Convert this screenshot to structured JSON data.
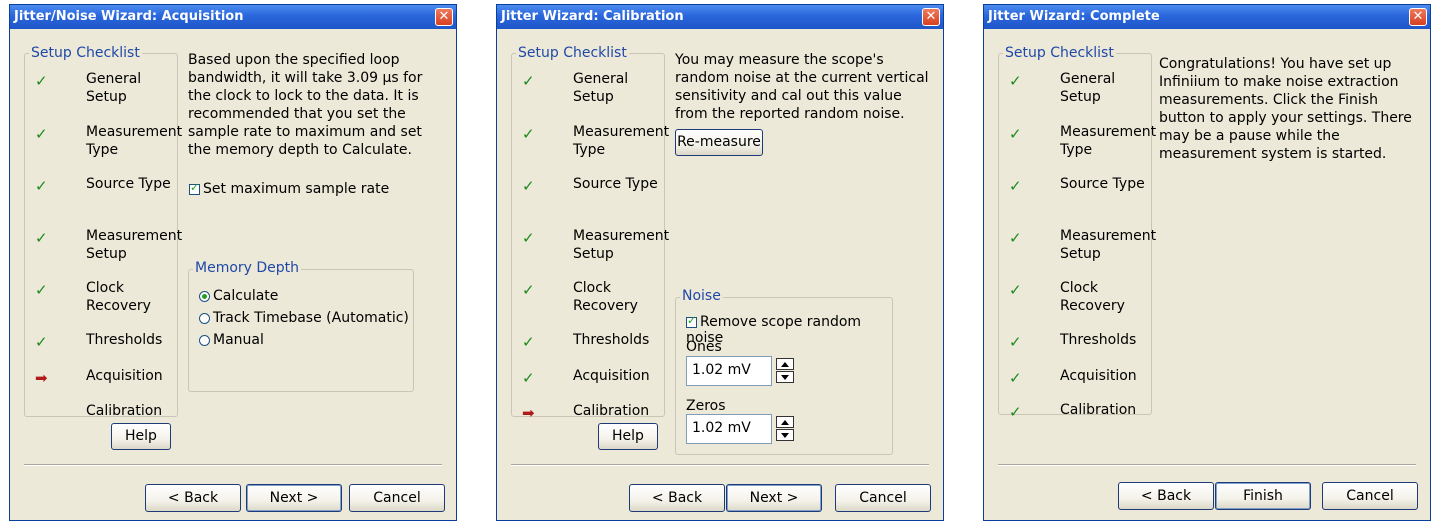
{
  "dialogs": [
    {
      "title": "Jitter/Noise Wizard: Acquisition",
      "checklist_title": "Setup Checklist",
      "items": [
        {
          "label": "General Setup",
          "status": "check"
        },
        {
          "label": "Measurement Type",
          "status": "check"
        },
        {
          "label": "Source Type",
          "status": "check"
        },
        {
          "label": "Measurement Setup",
          "status": "check"
        },
        {
          "label": "Clock Recovery",
          "status": "check"
        },
        {
          "label": "Thresholds",
          "status": "check"
        },
        {
          "label": "Acquisition",
          "status": "current"
        },
        {
          "label": "Calibration",
          "status": "none"
        }
      ],
      "description": "Based upon the specified loop bandwidth, it will take 3.09 µs for the clock to lock to the data. It is recommended that you set the sample rate to maximum and set the memory depth to Calculate.",
      "checkbox_label": "Set maximum sample rate",
      "memory_depth": {
        "title": "Memory Depth",
        "options": [
          "Calculate",
          "Track Timebase (Automatic)",
          "Manual"
        ],
        "selected": "Calculate"
      },
      "help_label": "Help",
      "back_label": "< Back",
      "next_label": "Next >",
      "cancel_label": "Cancel"
    },
    {
      "title": "Jitter Wizard: Calibration",
      "checklist_title": "Setup Checklist",
      "items": [
        {
          "label": "General Setup",
          "status": "check"
        },
        {
          "label": "Measurement Type",
          "status": "check"
        },
        {
          "label": "Source Type",
          "status": "check"
        },
        {
          "label": "Measurement Setup",
          "status": "check"
        },
        {
          "label": "Clock Recovery",
          "status": "check"
        },
        {
          "label": "Thresholds",
          "status": "check"
        },
        {
          "label": "Acquisition",
          "status": "check"
        },
        {
          "label": "Calibration",
          "status": "current"
        }
      ],
      "description": "You may measure the scope's random noise at the current vertical sensitivity and cal out this value from the reported random noise.",
      "remeasure_label": "Re-measure",
      "noise": {
        "title": "Noise",
        "checkbox_label": "Remove scope random noise",
        "ones_label": "Ones",
        "ones_value": "1.02 mV",
        "zeros_label": "Zeros",
        "zeros_value": "1.02 mV"
      },
      "help_label": "Help",
      "back_label": "< Back",
      "next_label": "Next >",
      "cancel_label": "Cancel"
    },
    {
      "title": "Jitter Wizard: Complete",
      "checklist_title": "Setup Checklist",
      "items": [
        {
          "label": "General Setup",
          "status": "check"
        },
        {
          "label": "Measurement Type",
          "status": "check"
        },
        {
          "label": "Source Type",
          "status": "check"
        },
        {
          "label": "Measurement Setup",
          "status": "check"
        },
        {
          "label": "Clock Recovery",
          "status": "check"
        },
        {
          "label": "Thresholds",
          "status": "check"
        },
        {
          "label": "Acquisition",
          "status": "check"
        },
        {
          "label": "Calibration",
          "status": "check"
        }
      ],
      "description": "Congratulations! You have set up Infiniium to make noise extraction measurements. Click the Finish button to apply your settings. There may be a pause while the measurement system is started.",
      "back_label": "< Back",
      "finish_label": "Finish",
      "cancel_label": "Cancel"
    }
  ],
  "icons": {
    "check": "✓",
    "current": "➡",
    "close": "✕"
  },
  "colors": {
    "title_bar": "#2a66dc",
    "check": "#1c8a1c",
    "current_arrow": "#b01a1a",
    "group_title": "#2048a8"
  }
}
